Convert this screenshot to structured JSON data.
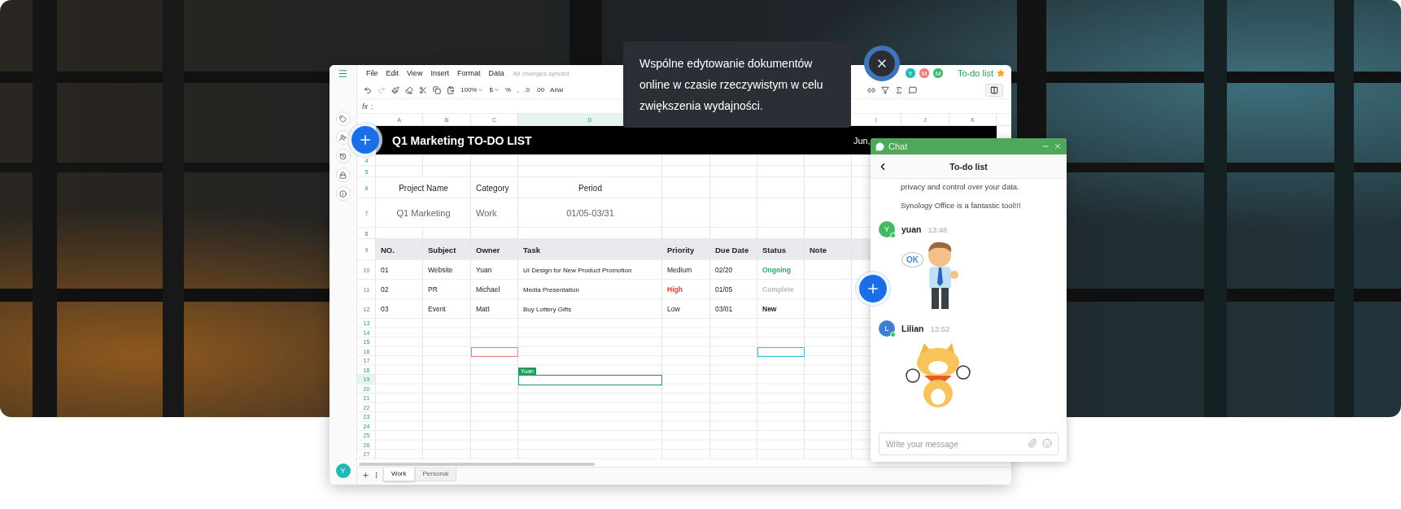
{
  "tooltip": {
    "text": "Wspólne edytowanie dokumentów online w czasie rzeczywistym w celu zwiększenia wydajności."
  },
  "spreadsheet": {
    "menu": [
      "File",
      "Edit",
      "View",
      "Insert",
      "Format",
      "Data"
    ],
    "sync_status": "All changes synced",
    "toolbar": {
      "zoom": "100%",
      "currency": "$",
      "percent": "%",
      "comma": ",",
      "decrease_decimals": ".0",
      "increase_decimals": ".00",
      "font": "Arial"
    },
    "formula_label": "fx",
    "formula_separator": ":",
    "collaborators": [
      {
        "initial": "Y",
        "color": "#22b8b4"
      },
      {
        "initial": "M",
        "color": "#f07878"
      },
      {
        "initial": "M",
        "color": "#3dba6c"
      }
    ],
    "doc_title": "To-do list",
    "starred": true,
    "column_headers": [
      {
        "label": "A",
        "selected": false
      },
      {
        "label": "B",
        "selected": false
      },
      {
        "label": "C",
        "selected": false
      },
      {
        "label": "D",
        "selected": true
      },
      {
        "label": "I",
        "selected": false
      },
      {
        "label": "J",
        "selected": false
      },
      {
        "label": "K",
        "selected": false
      }
    ],
    "title": "Q1 Marketing TO-DO LIST",
    "title_date": "Jun,",
    "row_numbers": [
      {
        "label": "4",
        "selected": false
      },
      {
        "label": "5",
        "selected": false
      },
      {
        "label": "6",
        "selected": false
      },
      {
        "label": "7",
        "selected": false
      },
      {
        "label": "8",
        "selected": false
      },
      {
        "label": "9",
        "selected": false
      },
      {
        "label": "10",
        "selected": false
      },
      {
        "label": "11",
        "selected": false
      },
      {
        "label": "12",
        "selected": false
      },
      {
        "label": "13",
        "selected": false
      },
      {
        "label": "14",
        "selected": false
      },
      {
        "label": "15",
        "selected": false
      },
      {
        "label": "16",
        "selected": false
      },
      {
        "label": "17",
        "selected": false
      },
      {
        "label": "18",
        "selected": false
      },
      {
        "label": "19",
        "selected": true
      },
      {
        "label": "20",
        "selected": false
      },
      {
        "label": "21",
        "selected": false
      },
      {
        "label": "22",
        "selected": false
      },
      {
        "label": "23",
        "selected": false
      },
      {
        "label": "24",
        "selected": false
      },
      {
        "label": "25",
        "selected": false
      },
      {
        "label": "26",
        "selected": false
      },
      {
        "label": "27",
        "selected": false
      }
    ],
    "project": {
      "headers": [
        "Project Name",
        "Category",
        "Period"
      ],
      "values": [
        "Q1 Marketing",
        "Work",
        "01/05-03/31"
      ]
    },
    "table": {
      "columns": [
        "NO.",
        "Subject",
        "Owner",
        "Task",
        "Priority",
        "Due Date",
        "Status",
        "Note"
      ],
      "rows": [
        {
          "no": "01",
          "subject": "Website",
          "owner": "Yuan",
          "task": "UI Design for New Product Promotion",
          "priority": {
            "text": "Medium",
            "urgent": false
          },
          "due": "02/20",
          "status": {
            "text": "Ongoing",
            "color": "#2aa86b"
          }
        },
        {
          "no": "02",
          "subject": "PR",
          "owner": "Michael",
          "task": "Media Presentation",
          "priority": {
            "text": "High",
            "urgent": true
          },
          "due": "01/05",
          "status": {
            "text": "Complete",
            "color": "#bbbbbb"
          }
        },
        {
          "no": "03",
          "subject": "Event",
          "owner": "Matt",
          "task": "Buy Lottery Gifts",
          "priority": {
            "text": "Low",
            "urgent": false
          },
          "due": "03/01",
          "status": {
            "text": "New",
            "color": "#222222"
          }
        }
      ]
    },
    "remote_selections": [
      {
        "color": "#f47c7c"
      },
      {
        "color": "#2cc4c8"
      },
      {
        "color": "#1f9a60",
        "user": "Yuan"
      }
    ],
    "sheet_tabs": [
      {
        "label": "Work",
        "selected": true
      },
      {
        "label": "Personal",
        "selected": false
      }
    ],
    "user_initial": "Y"
  },
  "chat": {
    "title": "Chat",
    "conversation": "To-do list",
    "messages": [
      {
        "kind": "text",
        "text": "privacy and control over your data."
      },
      {
        "kind": "text",
        "text": "Synology Office is a fantastic tool!!!"
      },
      {
        "kind": "man",
        "author": "yuan",
        "initial": "Y",
        "color": "#45b863",
        "online": true,
        "time": "13:48",
        "bubble": "OK"
      },
      {
        "kind": "dog",
        "author": "Lilian",
        "initial": "L",
        "color": "#3c7fd3",
        "online": true,
        "time": "13:52"
      }
    ],
    "placeholder": "Write your message"
  }
}
